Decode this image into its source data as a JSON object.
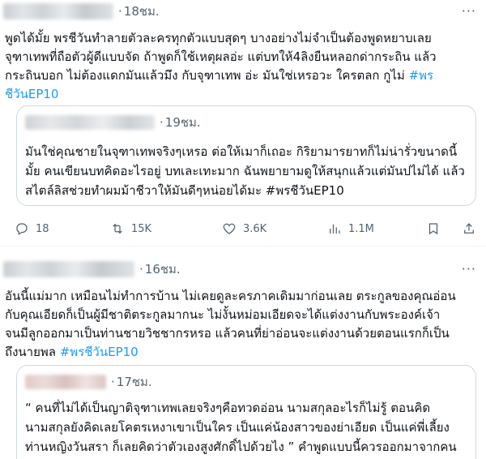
{
  "tweet1": {
    "time": "18ชม.",
    "more": "···",
    "lines": [
      "พูดได้มั้ย พรชีวันทำลายตัวละครทุกตัวแบบสุดๆ บางอย่างไม่จำเป็นต้องพูดหยาบเลย",
      "จุฑาเทพที่ถือตัวผู้ดีแบบจัด ถ้าพูดก็ใช้เหตุผลอ่ะ แต่บทให้4ลิงยืนหลอกด่ากระถิน แล้ว",
      "กระถินบอก ไม่ต้องแดกมันแล้วมึง กับจุฑาเทพ อ่ะ มันใช่เหรอวะ ใครตลก กูไม่ "
    ],
    "hashtag_a": "#พร",
    "hashtag_b": "ชีวันEP10",
    "quote": {
      "time": "19ชม.",
      "lines": [
        "มันใช่คุณชายในจุฑาเทพจริงๆเหรอ ต่อให้เมาก็เถอะ กิริยามารยาทก็ไม่น่ารั่วขนาดนี้",
        "มั้ย คนเขียนบทคิดอะไรอยู่ บทเละเทะมาก ฉันพยายามดูให้สนุกแล้วแต่มันปไม่ได้ แล้ว",
        "สไตล์ลิสช่วยทำผมม้าชีวาให้มันดีๆหน่อยได้มะ #พรชีวันEP10"
      ]
    },
    "actions": {
      "replies": "18",
      "reposts": "15K",
      "likes": "3.6K",
      "views": "1.1M"
    }
  },
  "tweet2": {
    "time": "16ชม.",
    "more": "···",
    "lines": [
      "อันนี้แม่มาก เหมือนไม่ทำการบ้าน ไม่เคยดูละครภาคเดิมมาก่อนเลย ตระกูลของคุณอ่อน",
      "กับคุณเอียดก็เป็นผู้มีชาติตระกูลมากนะ ไม่งั้นหม่อมเอียดจะได้แต่งงานกับพระองค์เจ้า",
      "จนมีลูกออกมาเป็นท่านชายวิชชากรหรอ แล้วคนที่ย่าอ่อนจะแต่งงานด้วยตอนแรกก็เป็น",
      "ถึงนายพล "
    ],
    "hashtag": "#พรชีวันEP10",
    "quote": {
      "time": "17ชม.",
      "lines": [
        "“ คนที่ไม่ได้เป็นญาติจุฑาเทพเลยจริงๆคือทวดอ่อน นามสกุลอะไรก็ไม่รู้ ตอนคิด",
        "นามสกุลยังคิดเลยโคตรเหงาเขาเป็นใคร เป็นแค่น้องสาวของย่าเอียด เป็นแค่พี่เลี้ยง",
        "ท่านหญิงวันสรา ก็เลยคิดว่าตัวเองสูงศักดิ์ไปด้วยไง ” คำพูดแบบนี้ควรออกมาจากคน"
      ]
    }
  },
  "icons": [
    "reply-icon",
    "repost-icon",
    "like-icon",
    "views-icon",
    "bookmark-icon",
    "share-icon",
    "more-icon"
  ],
  "colors": {
    "accent": "#1d9bf0",
    "text": "#0f1419",
    "muted": "#536471",
    "border": "#cfd9de"
  }
}
